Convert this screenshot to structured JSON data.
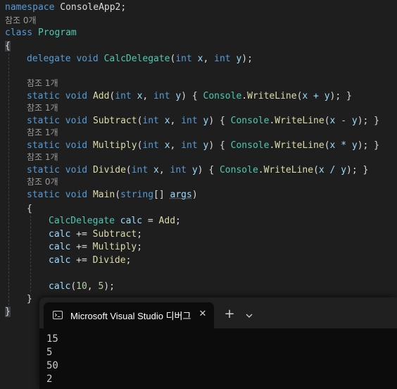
{
  "editor": {
    "line1": {
      "kw": "namespace",
      "name": " ConsoleApp2;"
    },
    "ref0": "참조 0개",
    "line3": {
      "kw": "class",
      "name": "Program"
    },
    "brace_open": "{",
    "delegate": {
      "kw1": "delegate",
      "kw2": "void",
      "fn": "CalcDelegate",
      "kw3": "int",
      "p1": "x",
      "kw4": "int",
      "p2": "y"
    },
    "ref_add": "참조 1개",
    "add": {
      "fn": "Add",
      "body": "x + y"
    },
    "ref_sub": "참조 1개",
    "subtract": {
      "fn": "Subtract",
      "body": "x - y"
    },
    "ref_mul": "참조 1개",
    "multiply": {
      "fn": "Multiply",
      "body": "x * y"
    },
    "ref_div": "참조 1개",
    "divide": {
      "fn": "Divide",
      "body": "x / y"
    },
    "ref_main": "참조 0개",
    "main": {
      "kw_static": "static",
      "kw_void": "void",
      "fn": "Main",
      "kw_string": "string",
      "args": "args"
    },
    "inner_open": "{",
    "calc_decl": {
      "type": "CalcDelegate",
      "var": "calc",
      "fn": "Add"
    },
    "calc_sub": "Subtract",
    "calc_mul": "Multiply",
    "calc_div": "Divide",
    "call": {
      "var": "calc",
      "a": "10",
      "b": "5"
    },
    "inner_close": "}",
    "brace_close": "}",
    "kw_static": "static",
    "kw_void": "void",
    "kw_int": "int",
    "console": "Console",
    "writeline": "WriteLine",
    "var_calc": "calc"
  },
  "terminal": {
    "tab_title": "Microsoft Visual Studio 디버그",
    "output": [
      "15",
      "5",
      "50",
      "2"
    ]
  },
  "colors": {
    "keyword": "#569cd6",
    "type": "#4ec9b0",
    "method": "#dcdcaa",
    "param": "#9cdcfe",
    "number": "#b5cea8",
    "editor_bg": "#1e1e1e",
    "terminal_bg": "#0c0c0c"
  },
  "icons": {
    "terminal_tab": "console-icon",
    "close": "close-icon",
    "new_tab": "plus-icon",
    "dropdown": "chevron-down-icon"
  }
}
